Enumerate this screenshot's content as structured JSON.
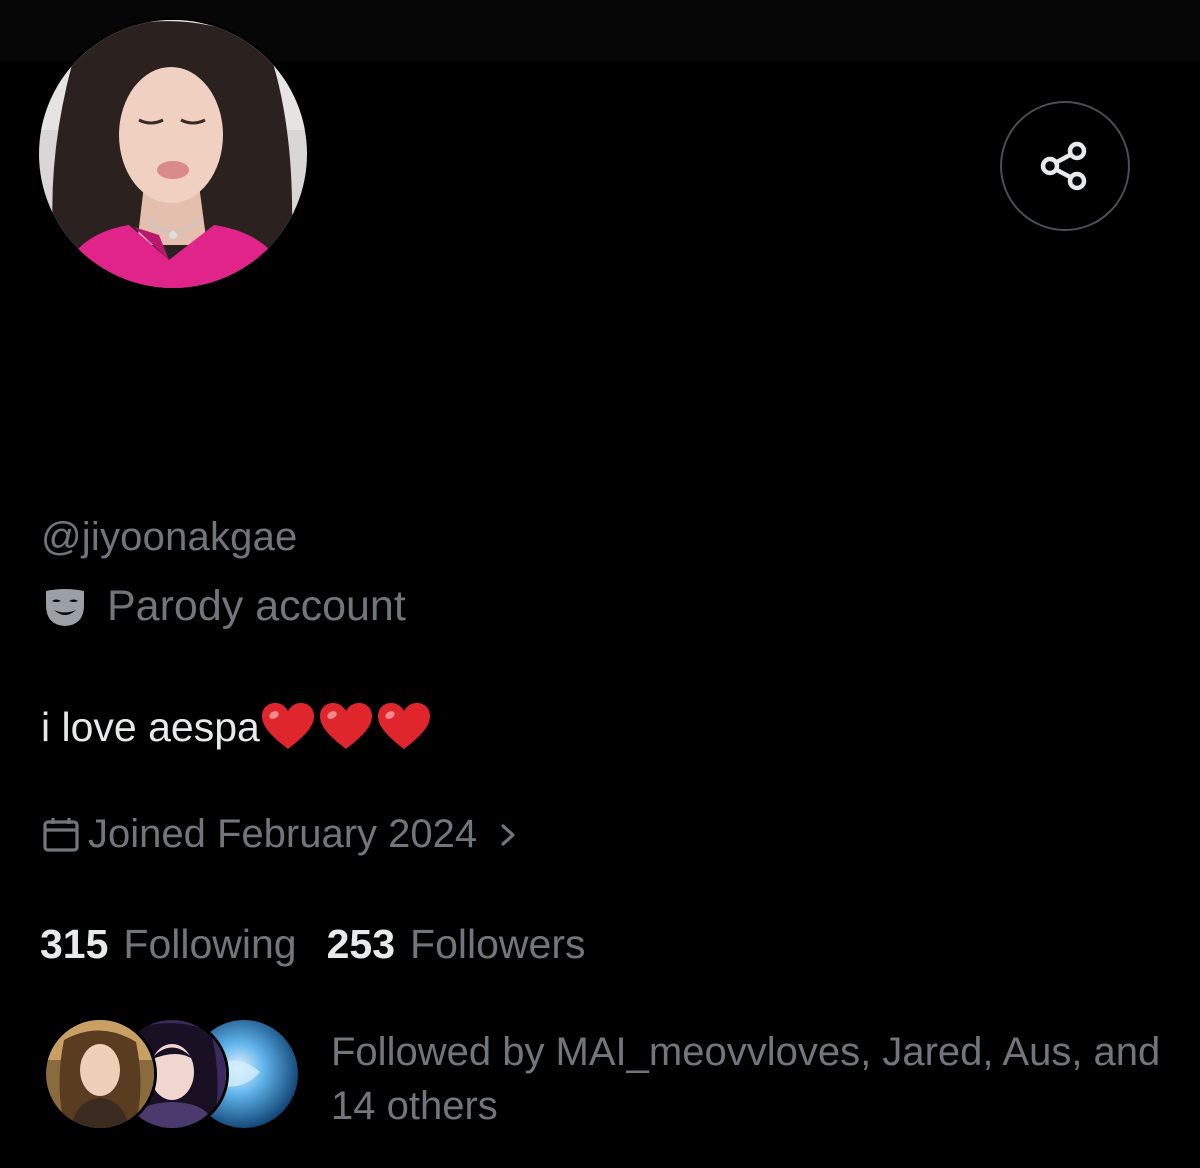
{
  "profile": {
    "handle": "@jiyoonakgae",
    "parody_label": "Parody account",
    "bio_text": "i love aespa",
    "bio_emoji": [
      "heart-emoji",
      "heart-emoji",
      "heart-emoji"
    ],
    "joined_text": "Joined February 2024",
    "following_count": "315",
    "following_label": "Following",
    "followers_count": "253",
    "followers_label": "Followers",
    "followed_by_text": "Followed by MAI_meovvloves, Jared, Aus, and 14 others"
  },
  "icons": {
    "share": "share-icon",
    "parody": "mask-icon",
    "joined": "calendar-icon",
    "joined_more": "chevron-right-icon"
  },
  "colors": {
    "background": "#000000",
    "primary_text": "#e7e9ea",
    "secondary_text": "#71767b",
    "heart": "#e0262d",
    "avatar_shirt": "#e0248a"
  }
}
